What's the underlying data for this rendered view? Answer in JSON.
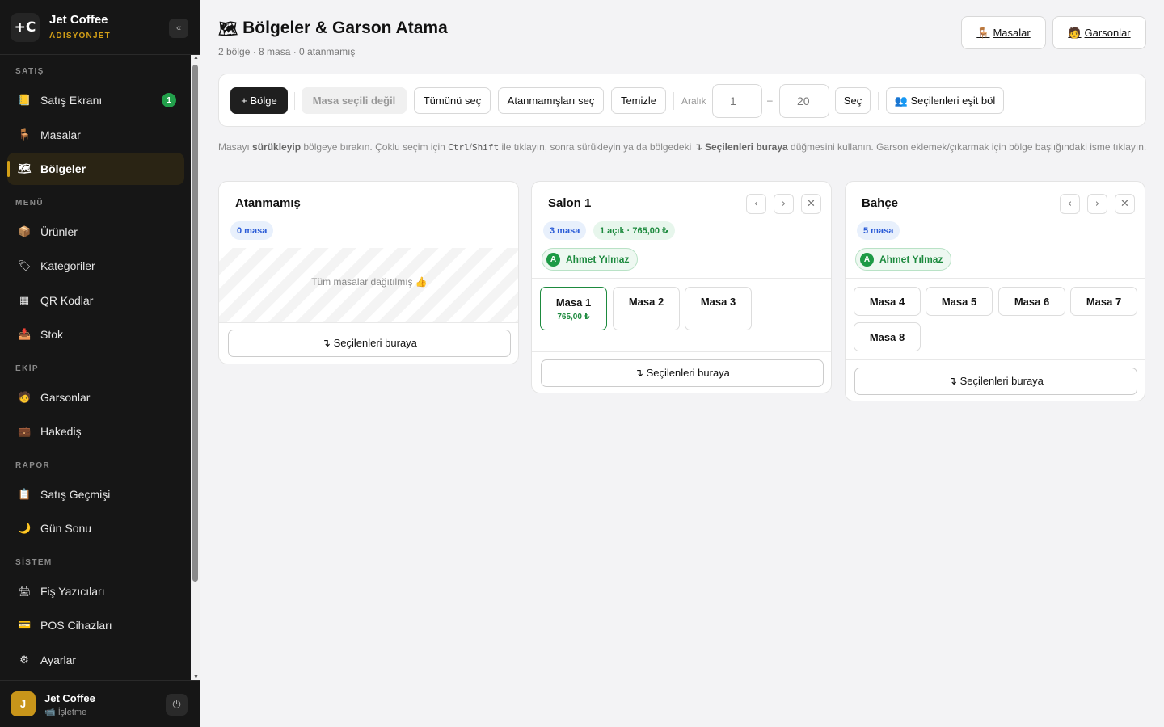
{
  "sidebar": {
    "logo": "+C",
    "brand_name": "Jet Coffee",
    "brand_sub": "ADISYONJET",
    "collapse": "«",
    "sections": {
      "satis": "SATIŞ",
      "menu": "MENÜ",
      "ekip": "EKİP",
      "rapor": "RAPOR",
      "sistem": "SİSTEM"
    },
    "items": {
      "satis_ekrani": {
        "icon": "📒",
        "label": "Satış Ekranı",
        "badge": "1"
      },
      "masalar": {
        "icon": "🪑",
        "label": "Masalar"
      },
      "bolgeler": {
        "icon": "🗺",
        "label": "Bölgeler"
      },
      "urunler": {
        "icon": "📦",
        "label": "Ürünler"
      },
      "kategoriler": {
        "icon": "🏷",
        "label": "Kategoriler"
      },
      "qr_kodlar": {
        "icon": "▦",
        "label": "QR Kodlar"
      },
      "stok": {
        "icon": "📥",
        "label": "Stok"
      },
      "garsonlar": {
        "icon": "🧑",
        "label": "Garsonlar"
      },
      "hakedis": {
        "icon": "💼",
        "label": "Hakediş"
      },
      "satis_gecmisi": {
        "icon": "📋",
        "label": "Satış Geçmişi"
      },
      "gun_sonu": {
        "icon": "🌙",
        "label": "Gün Sonu"
      },
      "fis_yazicilari": {
        "icon": "🖨",
        "label": "Fiş Yazıcıları"
      },
      "pos_cihazlari": {
        "icon": "💳",
        "label": "POS Cihazları"
      },
      "ayarlar": {
        "icon": "⚙",
        "label": "Ayarlar"
      }
    },
    "user": {
      "initial": "J",
      "name": "Jet Coffee",
      "role": "📹 İşletme",
      "power": "⏻"
    }
  },
  "header": {
    "title_icon": "🗺",
    "title": "Bölgeler & Garson Atama",
    "subtitle": "2 bölge · 8 masa · 0 atanmamış",
    "masalar_btn": {
      "icon": "🪑",
      "label": "Masalar"
    },
    "garsonlar_btn": {
      "icon": "🧑",
      "label": "Garsonlar"
    }
  },
  "toolbar": {
    "add_region": "+ Bölge",
    "no_selection": "Masa seçili değil",
    "select_all": "Tümünü seç",
    "select_unassigned": "Atanmamışları seç",
    "clear": "Temizle",
    "range_label": "Aralık",
    "range_from": "1",
    "range_dash": "–",
    "range_to": "20",
    "select_range": "Seç",
    "split_equal": "👥 Seçilenleri eşit böl"
  },
  "hint": {
    "p1": "Masayı ",
    "b1": "sürükleyip",
    "p2": " bölgeye bırakın. Çoklu seçim için ",
    "c1": "Ctrl",
    "p3": "/",
    "c2": "Shift",
    "p4": " ile tıklayın, sonra sürükleyin ya da bölgedeki ",
    "b2": "↴ Seçilenleri buraya",
    "p5": " düğmesini kullanın. Garson eklemek/çıkarmak için bölge başlığındaki isme tıklayın."
  },
  "regions": {
    "unassigned": {
      "name": "Atanmamış",
      "count": "0 masa",
      "empty": "Tüm masalar dağıtılmış 👍",
      "drop": "↴ Seçilenleri buraya"
    },
    "salon": {
      "name": "Salon 1",
      "count": "3 masa",
      "open": "1 açık · 765,00 ₺",
      "waiter_initial": "A",
      "waiter": "Ahmet Yılmaz",
      "prev": "‹",
      "next": "›",
      "close": "✕",
      "tables": [
        {
          "name": "Masa 1",
          "amount": "765,00 ₺"
        },
        {
          "name": "Masa 2"
        },
        {
          "name": "Masa 3"
        }
      ],
      "drop": "↴ Seçilenleri buraya"
    },
    "bahce": {
      "name": "Bahçe",
      "count": "5 masa",
      "waiter_initial": "A",
      "waiter": "Ahmet Yılmaz",
      "prev": "‹",
      "next": "›",
      "close": "✕",
      "tables": [
        {
          "name": "Masa 4"
        },
        {
          "name": "Masa 5"
        },
        {
          "name": "Masa 6"
        },
        {
          "name": "Masa 7"
        },
        {
          "name": "Masa 8"
        }
      ],
      "drop": "↴ Seçilenleri buraya"
    }
  },
  "colors": {
    "accent": "#d4a017",
    "sidebar_bg": "#161616",
    "success": "#1d8a3e",
    "info": "#2a5bd7"
  }
}
